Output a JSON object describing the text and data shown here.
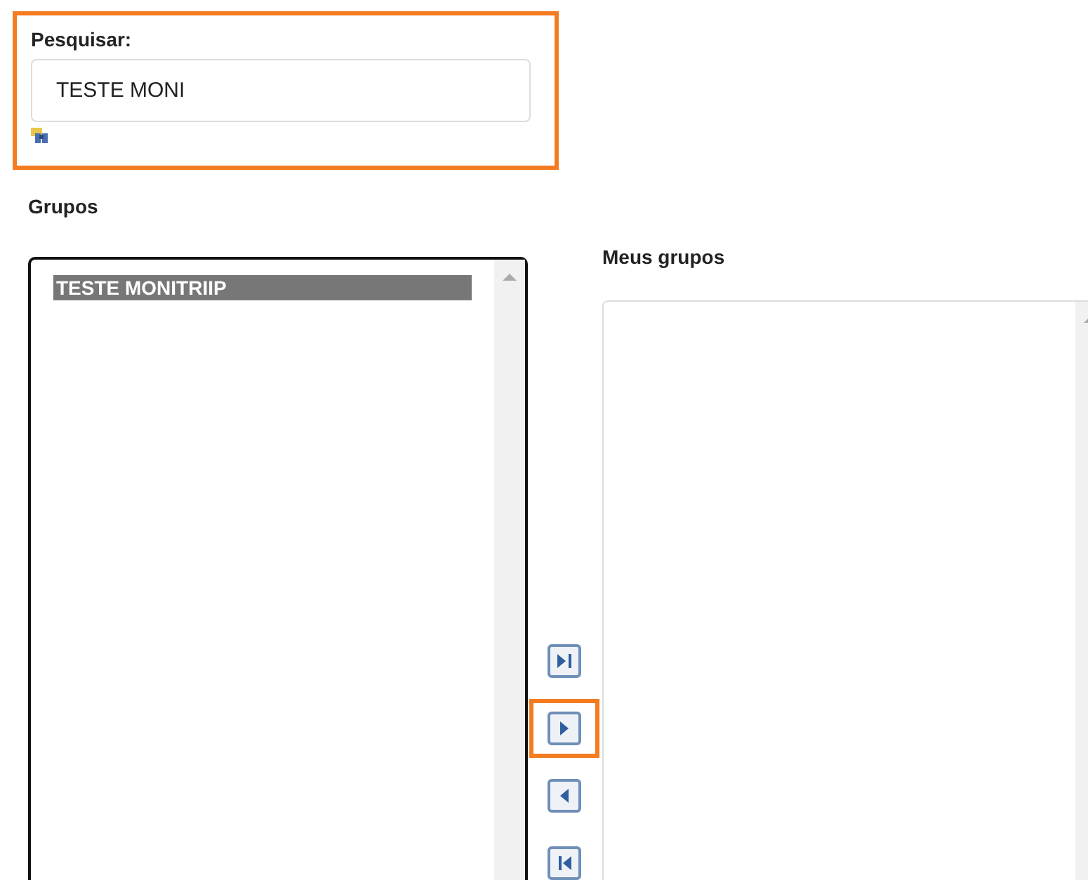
{
  "search": {
    "label": "Pesquisar:",
    "value": "TESTE MONI",
    "highlighted": true
  },
  "available": {
    "label": "Grupos",
    "items": [
      {
        "text": "TESTE MONITRIIP",
        "selected": true
      }
    ]
  },
  "transfer_buttons": [
    {
      "kind": "move-all-right",
      "highlighted": false
    },
    {
      "kind": "move-right",
      "highlighted": true
    },
    {
      "kind": "move-left",
      "highlighted": false
    },
    {
      "kind": "move-all-left",
      "highlighted": false
    }
  ],
  "chosen": {
    "label": "Meus grupos"
  }
}
